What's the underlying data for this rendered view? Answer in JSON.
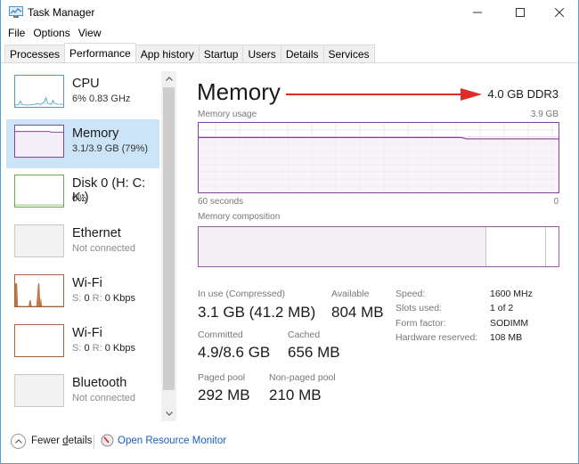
{
  "window": {
    "title": "Task Manager",
    "controls": {
      "minimize": "—",
      "maximize": "☐",
      "close": "✕"
    }
  },
  "menu": [
    "File",
    "Options",
    "View"
  ],
  "tabs": [
    {
      "label": "Processes",
      "active": false
    },
    {
      "label": "Performance",
      "active": true
    },
    {
      "label": "App history",
      "active": false
    },
    {
      "label": "Startup",
      "active": false
    },
    {
      "label": "Users",
      "active": false
    },
    {
      "label": "Details",
      "active": false
    },
    {
      "label": "Services",
      "active": false
    }
  ],
  "sidebar": {
    "items": [
      {
        "title": "CPU",
        "subtitle": "6% 0.83 GHz",
        "icon": "cpu-graph",
        "color": "#4a9bc5",
        "selected": false
      },
      {
        "title": "Memory",
        "subtitle": "3.1/3.9 GB (79%)",
        "icon": "memory-graph",
        "color": "#8b3f9e",
        "selected": true
      },
      {
        "title": "Disk 0 (H: C: K:)",
        "subtitle": "0%",
        "icon": "disk-graph",
        "color": "#6aa84f",
        "selected": false
      },
      {
        "title": "Ethernet",
        "subtitle": "Not connected",
        "icon": "ethernet-graph",
        "color": "#c8c8c8",
        "selected": false
      },
      {
        "title": "Wi-Fi",
        "sub_s_label": "S:",
        "sub_s_value": "0",
        "sub_r_label": "R:",
        "sub_r_value": "0 Kbps",
        "icon": "wifi-graph",
        "color": "#a7653b",
        "selected": false
      },
      {
        "title": "Wi-Fi",
        "sub_s_label": "S:",
        "sub_s_value": "0",
        "sub_r_label": "R:",
        "sub_r_value": "0 Kbps",
        "icon": "wifi-graph",
        "color": "#a7653b",
        "selected": false
      },
      {
        "title": "Bluetooth",
        "subtitle": "Not connected",
        "icon": "bluetooth-graph",
        "color": "#c8c8c8",
        "selected": false
      }
    ]
  },
  "main": {
    "title": "Memory",
    "spec": "4.0 GB DDR3",
    "annotation_arrow_color": "#e02b2b",
    "usage": {
      "label": "Memory usage",
      "max": "3.9 GB",
      "time_start": "60 seconds",
      "time_end": "0",
      "line_color": "#8b3f9e",
      "fill_color": "#f4eef6",
      "history_fraction": {
        "before": 0.79,
        "after": 0.77,
        "change_at": 0.73
      }
    },
    "composition": {
      "label": "Memory composition",
      "in_use_fraction": 0.8,
      "standby_fraction": 0.165
    },
    "stats": {
      "in_use_label": "In use (Compressed)",
      "in_use_value": "3.1 GB (41.2 MB)",
      "available_label": "Available",
      "available_value": "804 MB",
      "committed_label": "Committed",
      "committed_value": "4.9/8.6 GB",
      "cached_label": "Cached",
      "cached_value": "656 MB",
      "paged_label": "Paged pool",
      "paged_value": "292 MB",
      "nonpaged_label": "Non-paged pool",
      "nonpaged_value": "210 MB"
    },
    "details": [
      {
        "label": "Speed:",
        "value": "1600 MHz"
      },
      {
        "label": "Slots used:",
        "value": "1 of 2"
      },
      {
        "label": "Form factor:",
        "value": "SODIMM"
      },
      {
        "label": "Hardware reserved:",
        "value": "108 MB"
      }
    ]
  },
  "footer": {
    "fewer_details_pre": "Fewer ",
    "fewer_details_u": "d",
    "fewer_details_post": "etails",
    "resource_monitor": "Open Resource Monitor"
  }
}
